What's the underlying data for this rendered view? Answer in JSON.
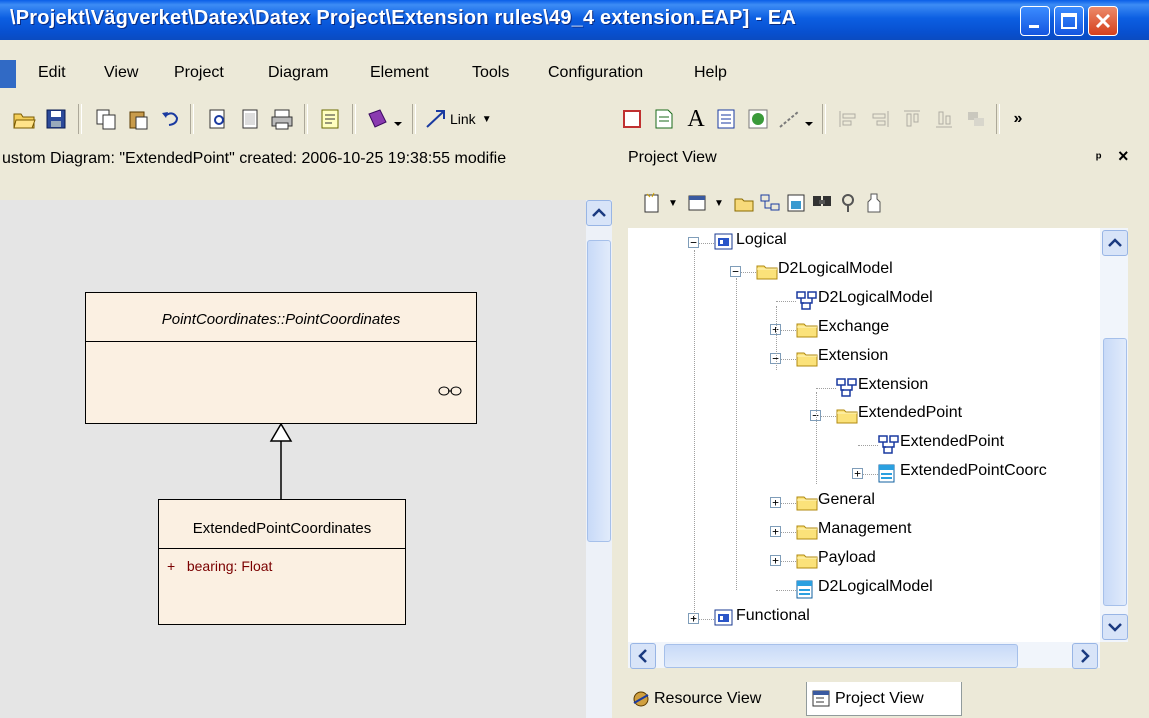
{
  "window": {
    "title": "\\Projekt\\Vägverket\\Datex\\Datex Project\\Extension rules\\49_4 extension.EAP] - EA"
  },
  "menu": {
    "items": [
      "Edit",
      "View",
      "Project",
      "Diagram",
      "Element",
      "Tools",
      "Configuration",
      "Help"
    ]
  },
  "toolbar": {
    "link_label": "Link",
    "overflow": "»"
  },
  "diagram": {
    "header": "ustom Diagram: \"ExtendedPoint\"   created: 2006-10-25 19:38:55  modifie",
    "classes": {
      "parent": {
        "name": "PointCoordinates::PointCoordinates"
      },
      "child": {
        "name": "ExtendedPointCoordinates",
        "attribute": "+   bearing: Float"
      }
    }
  },
  "project_view": {
    "title": "Project View",
    "pin": "ᵖ",
    "close": "×",
    "tree": [
      {
        "label": "Logical",
        "icon": "package-icon",
        "level": 0,
        "expander": "−"
      },
      {
        "label": "D2LogicalModel",
        "icon": "folder-icon",
        "level": 1,
        "expander": "−"
      },
      {
        "label": "D2LogicalModel",
        "icon": "diagram-icon",
        "level": 2,
        "expander": ""
      },
      {
        "label": "Exchange",
        "icon": "folder-icon",
        "level": 2,
        "expander": "+"
      },
      {
        "label": "Extension",
        "icon": "folder-icon",
        "level": 2,
        "expander": "−"
      },
      {
        "label": "Extension",
        "icon": "diagram-icon",
        "level": 3,
        "expander": ""
      },
      {
        "label": "ExtendedPoint",
        "icon": "folder-icon",
        "level": 3,
        "expander": "−"
      },
      {
        "label": "ExtendedPoint",
        "icon": "diagram-icon",
        "level": 4,
        "expander": ""
      },
      {
        "label": "ExtendedPointCoorc",
        "icon": "class-icon",
        "level": 4,
        "expander": "+"
      },
      {
        "label": "General",
        "icon": "folder-icon",
        "level": 2,
        "expander": "+"
      },
      {
        "label": "Management",
        "icon": "folder-icon",
        "level": 2,
        "expander": "+"
      },
      {
        "label": "Payload",
        "icon": "folder-icon",
        "level": 2,
        "expander": "+"
      },
      {
        "label": "D2LogicalModel",
        "icon": "class-icon",
        "level": 2,
        "expander": ""
      },
      {
        "label": "Functional",
        "icon": "package-icon",
        "level": 0,
        "expander": "+"
      }
    ],
    "tabs": [
      "Resource View",
      "Project View"
    ],
    "active_tab": "Project View"
  }
}
